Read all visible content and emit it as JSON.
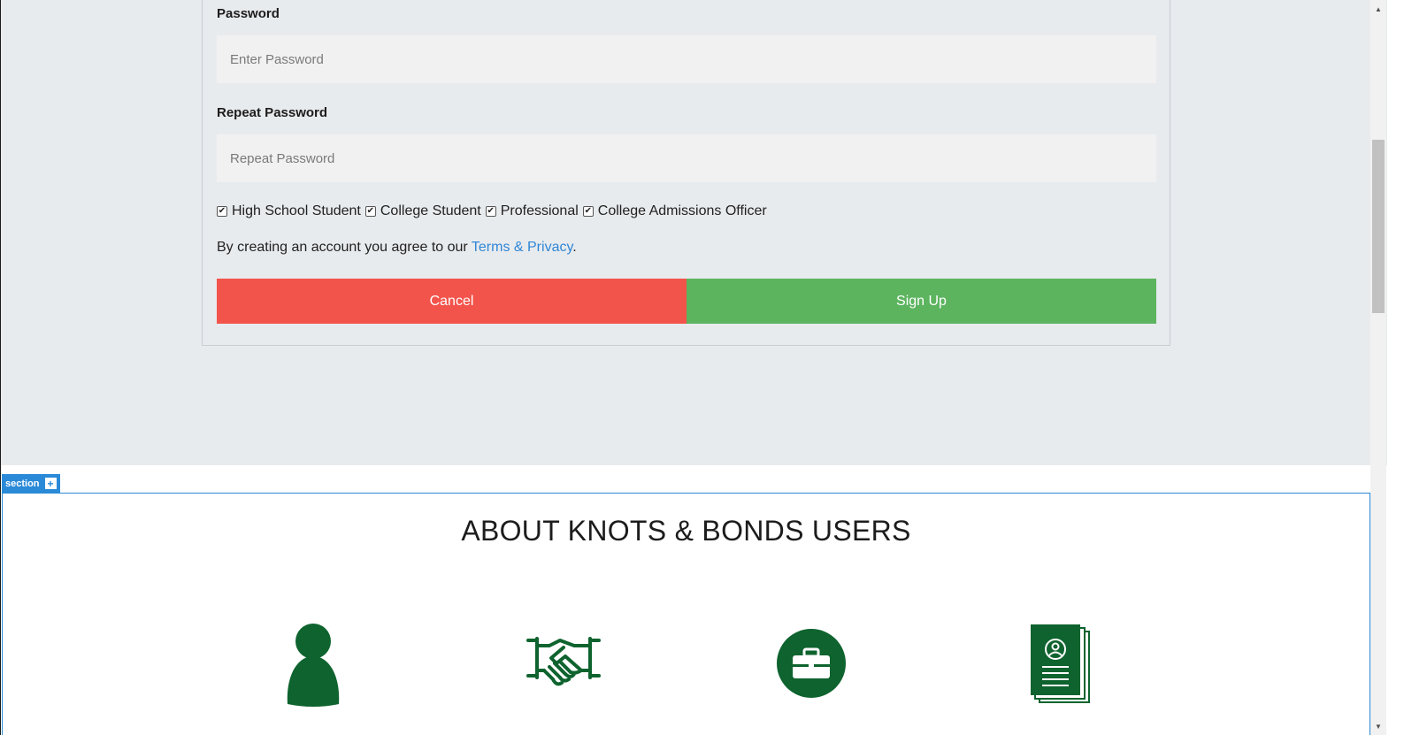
{
  "form": {
    "password_label": "Password",
    "password_placeholder": "Enter Password",
    "repeat_label": "Repeat Password",
    "repeat_placeholder": "Repeat Password",
    "roles": [
      {
        "label": "High School Student",
        "checked": true
      },
      {
        "label": "College Student",
        "checked": true
      },
      {
        "label": "Professional",
        "checked": true
      },
      {
        "label": "College Admissions Officer",
        "checked": true
      }
    ],
    "agree_text": "By creating an account you agree to our ",
    "terms_link": "Terms & Privacy",
    "agree_end": ".",
    "cancel_label": "Cancel",
    "signup_label": "Sign Up"
  },
  "editor": {
    "section_tag": "section",
    "add_symbol": "+"
  },
  "about": {
    "title": "ABOUT KNOTS & BONDS USERS",
    "icons": [
      "person-icon",
      "handshake-icon",
      "briefcase-icon",
      "document-profile-icon"
    ]
  },
  "colors": {
    "cancel": "#f2544b",
    "signup": "#5cb45f",
    "link": "#2f86d6",
    "icon_green": "#0e632e",
    "editor_accent": "#2a8ad8"
  }
}
